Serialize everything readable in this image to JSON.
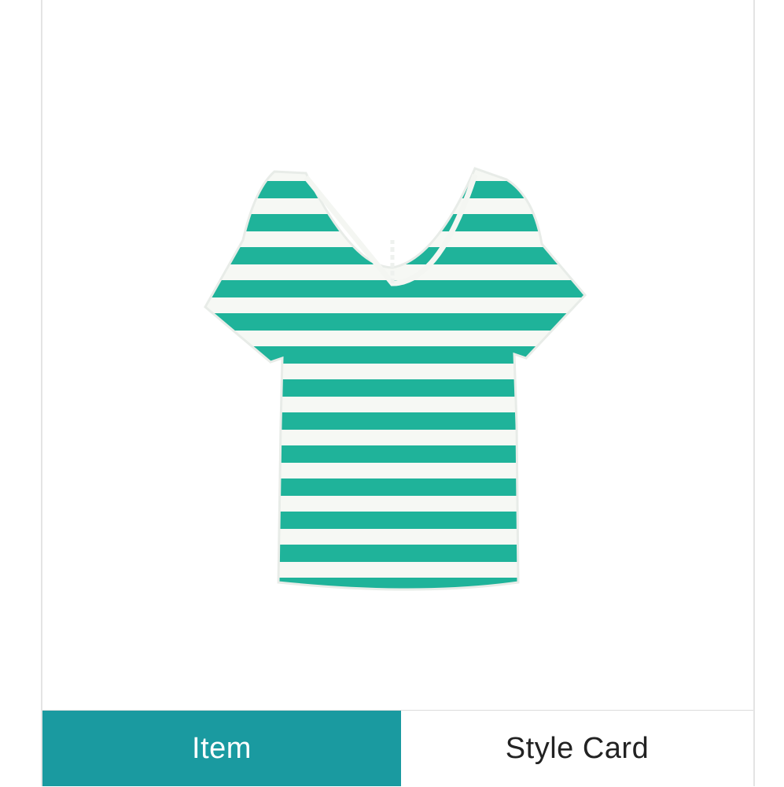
{
  "product": {
    "image_icon": "striped-v-neck-tee-image",
    "colors": {
      "stripe": "#1fb39a",
      "base": "#f6f8f4"
    }
  },
  "tabs": [
    {
      "label": "Item",
      "selected": true
    },
    {
      "label": "Style Card",
      "selected": false
    }
  ],
  "colors": {
    "accent": "#1a9aa0",
    "border": "#e4e4e4"
  }
}
